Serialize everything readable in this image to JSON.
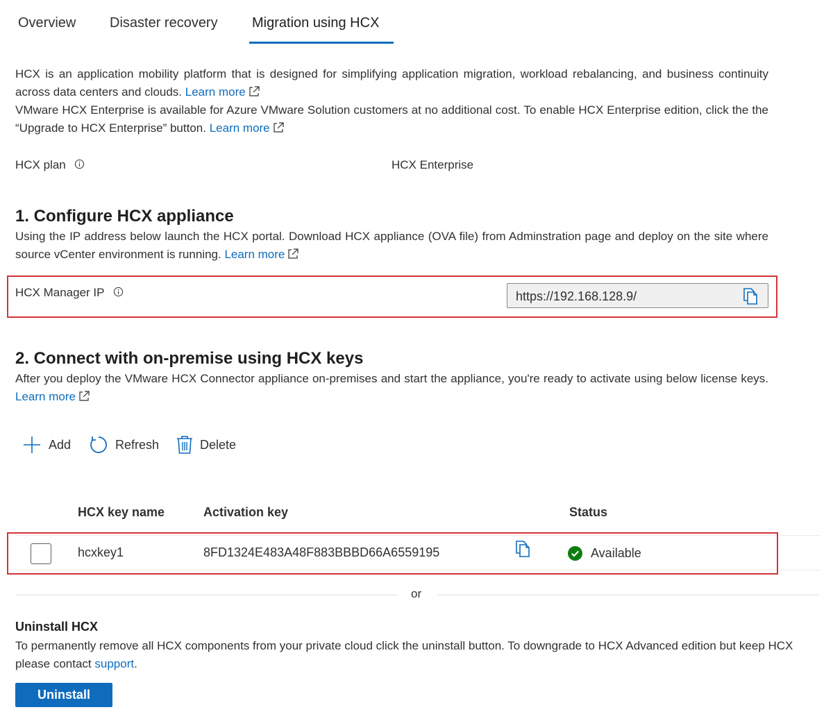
{
  "tabs": [
    {
      "label": "Overview"
    },
    {
      "label": "Disaster recovery"
    },
    {
      "label": "Migration using HCX",
      "active": true
    }
  ],
  "intro": {
    "line1": "HCX is an application mobility platform that is designed for simplifying application migration, workload rebalancing, and business continuity across data centers and clouds.",
    "line1_link": "Learn more",
    "line2": "VMware HCX Enterprise is available for Azure VMware Solution customers at no additional cost. To enable HCX Enterprise edition, click the the “Upgrade to HCX Enterprise” button.",
    "line2_link": "Learn more"
  },
  "plan": {
    "label": "HCX plan",
    "value": "HCX Enterprise"
  },
  "configure": {
    "title": "1. Configure HCX appliance",
    "description": "Using the IP address below launch the HCX portal. Download HCX appliance (OVA file) from Adminstration page and deploy on the site where source vCenter environment is running.",
    "link": "Learn more",
    "manager_ip_label": "HCX Manager IP",
    "manager_ip_value": "https://192.168.128.9/"
  },
  "connect": {
    "title": "2. Connect with on-premise using HCX keys",
    "description": "After you deploy the VMware HCX Connector appliance on-premises and start the appliance, you're ready to activate using below license keys.",
    "link": "Learn more"
  },
  "toolbar": {
    "add_label": "Add",
    "refresh_label": "Refresh",
    "delete_label": "Delete"
  },
  "table": {
    "columns": [
      "HCX key name",
      "Activation key",
      "Status"
    ],
    "rows": [
      {
        "name": "hcxkey1",
        "activation_key": "8FD1324E483A48F883BBBD66A6559195",
        "status": "Available"
      }
    ]
  },
  "separator_text": "or",
  "uninstall": {
    "title": "Uninstall HCX",
    "description": "To permanently remove all HCX components from your private cloud click the uninstall button. To downgrade to HCX Advanced edition but keep HCX please contact",
    "link": "support",
    "after_link": ".",
    "button_label": "Uninstall"
  },
  "colors": {
    "accent": "#0f6cbd",
    "highlight_border": "#d13438",
    "status_available": "#107c10"
  },
  "icons": {
    "info": "info-icon",
    "external_link": "external-link-icon",
    "copy": "copy-icon",
    "add": "plus-icon",
    "refresh": "refresh-icon",
    "delete": "trash-icon",
    "status": "check-circle-icon"
  }
}
